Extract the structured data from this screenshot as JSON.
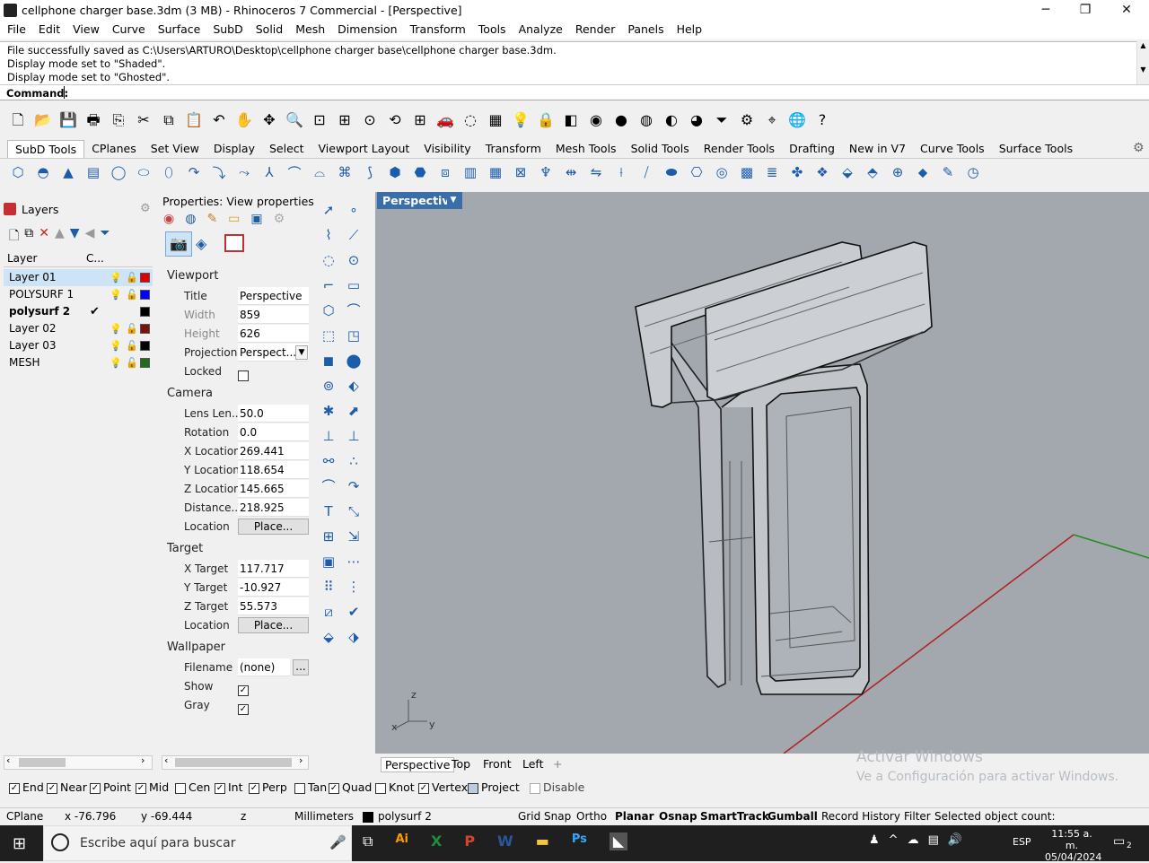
{
  "window": {
    "title": "cellphone charger base.3dm (3 MB) - Rhinoceros 7 Commercial - [Perspective]",
    "minimize": "─",
    "maximize": "❐",
    "close": "✕"
  },
  "menu": [
    "File",
    "Edit",
    "View",
    "Curve",
    "Surface",
    "SubD",
    "Solid",
    "Mesh",
    "Dimension",
    "Transform",
    "Tools",
    "Analyze",
    "Render",
    "Panels",
    "Help"
  ],
  "history": [
    "File successfully saved as C:\\Users\\ARTURO\\Desktop\\cellphone charger base\\cellphone charger base.3dm.",
    "Display mode set to \"Shaded\".",
    "Display mode set to \"Ghosted\"."
  ],
  "command": {
    "label": "Command:",
    "value": ""
  },
  "standard_toolbar_icons": [
    "new-icon",
    "open-icon",
    "save-icon",
    "print-icon",
    "import-icon",
    "cut-icon",
    "copy-icon",
    "paste-icon",
    "undo-icon",
    "pan-icon",
    "move-icon",
    "zoom-icon",
    "zoom-window-icon",
    "zoom-extents-icon",
    "zoom-selected-icon",
    "rotate-view-icon",
    "four-views-icon",
    "car-icon",
    "hide-icon",
    "grid-icon",
    "bulb-icon",
    "lock-icon",
    "layer-icon",
    "color-wheel-icon",
    "sphere-icon",
    "shaded-sphere-icon",
    "render-sphere-icon",
    "material-sphere-icon",
    "filter-icon",
    "options-icon",
    "snap-icon",
    "globe-icon",
    "help-icon"
  ],
  "tabs": [
    "SubD Tools",
    "CPlanes",
    "Set View",
    "Display",
    "Select",
    "Viewport Layout",
    "Visibility",
    "Transform",
    "Mesh Tools",
    "Solid Tools",
    "Render Tools",
    "Drafting",
    "New in V7",
    "Curve Tools",
    "Surface Tools"
  ],
  "active_tab": "SubD Tools",
  "layers": {
    "panel_title": "Layers",
    "col_layer": "Layer",
    "col_c": "C...",
    "rows": [
      {
        "name": "Layer 01",
        "current": false,
        "color": "#e00000",
        "selected": true,
        "bold": false
      },
      {
        "name": "POLYSURF 1",
        "current": false,
        "color": "#0000ff",
        "selected": false,
        "bold": false
      },
      {
        "name": "polysurf 2",
        "current": true,
        "color": "#000000",
        "selected": false,
        "bold": true
      },
      {
        "name": "Layer 02",
        "current": false,
        "color": "#7a1010",
        "selected": false,
        "bold": false
      },
      {
        "name": "Layer 03",
        "current": false,
        "color": "#000000",
        "selected": false,
        "bold": false
      },
      {
        "name": "MESH",
        "current": false,
        "color": "#1e6e1e",
        "selected": false,
        "bold": false
      }
    ]
  },
  "properties": {
    "title": "Properties: View properties",
    "viewport": {
      "label": "Viewport",
      "title_label": "Title",
      "title": "Perspective",
      "width_label": "Width",
      "width": "859",
      "height_label": "Height",
      "height": "626",
      "projection_label": "Projection",
      "projection": "Perspect...",
      "locked_label": "Locked"
    },
    "camera": {
      "label": "Camera",
      "lens_label": "Lens Len...",
      "lens": "50.0",
      "rotation_label": "Rotation",
      "rotation": "0.0",
      "xloc_label": "X Location",
      "xloc": "269.441",
      "yloc_label": "Y Location",
      "yloc": "118.654",
      "zloc_label": "Z Location",
      "zloc": "145.665",
      "dist_label": "Distance...",
      "dist": "218.925",
      "location_label": "Location",
      "place": "Place..."
    },
    "target": {
      "label": "Target",
      "x_label": "X Target",
      "x": "117.717",
      "y_label": "Y Target",
      "y": "-10.927",
      "z_label": "Z Target",
      "z": "55.573",
      "location_label": "Location",
      "place": "Place..."
    },
    "wallpaper": {
      "label": "Wallpaper",
      "filename_label": "Filename",
      "filename": "(none)",
      "browse": "...",
      "show_label": "Show",
      "gray_label": "Gray"
    }
  },
  "viewport": {
    "label": "Perspective",
    "tabs": [
      "Perspective",
      "Top",
      "Front",
      "Left"
    ],
    "add": "+",
    "axis_z": "z",
    "axis_y": "y",
    "axis_x": "x"
  },
  "osnaps": [
    {
      "label": "End",
      "checked": true
    },
    {
      "label": "Near",
      "checked": true
    },
    {
      "label": "Point",
      "checked": true
    },
    {
      "label": "Mid",
      "checked": true
    },
    {
      "label": "Cen",
      "checked": false
    },
    {
      "label": "Int",
      "checked": true
    },
    {
      "label": "Perp",
      "checked": true
    },
    {
      "label": "Tan",
      "checked": false
    },
    {
      "label": "Quad",
      "checked": true
    },
    {
      "label": "Knot",
      "checked": false
    },
    {
      "label": "Vertex",
      "checked": true
    },
    {
      "label": "Project",
      "checked": true
    },
    {
      "label": "Disable",
      "checked": false
    }
  ],
  "status": {
    "cplane": "CPlane",
    "x": "x -76.796",
    "y": "y -69.444",
    "z": "z",
    "units": "Millimeters",
    "layer": "polysurf 2",
    "grid_snap": "Grid Snap",
    "ortho": "Ortho",
    "planar": "Planar",
    "osnap": "Osnap",
    "smarttrack": "SmartTrack",
    "gumball": "Gumball",
    "record_history": "Record History",
    "filter": "Filter",
    "selected": "Selected object count:"
  },
  "watermark": {
    "line1": "Activar Windows",
    "line2": "Ve a Configuración para activar Windows."
  },
  "taskbar": {
    "search_placeholder": "Escribe aquí para buscar",
    "lang": "ESP",
    "time": "11:55 a. m.",
    "date": "05/04/2024",
    "notif": "2"
  }
}
